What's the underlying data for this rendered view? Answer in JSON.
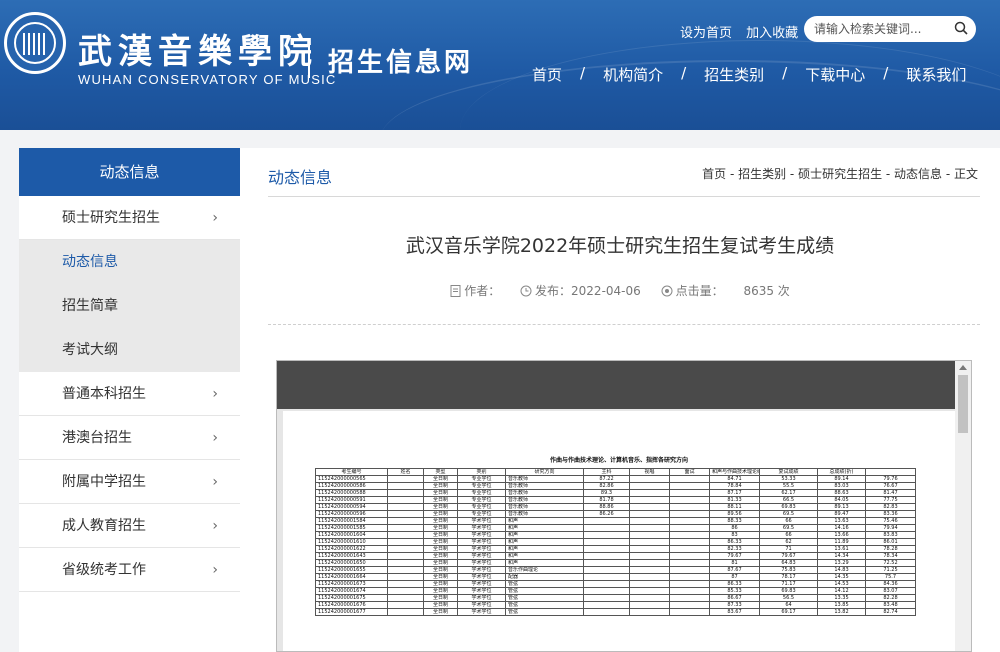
{
  "header": {
    "logo_cn": "武漢音樂學院",
    "logo_en": "WUHAN CONSERVATORY OF MUSIC",
    "site_name": "招生信息网",
    "top_links": [
      "设为首页",
      "加入收藏"
    ],
    "search_placeholder": "请输入检索关键词...",
    "nav": [
      "首页",
      "机构简介",
      "招生类别",
      "下载中心",
      "联系我们"
    ]
  },
  "sidebar": {
    "title": "动态信息",
    "items": [
      {
        "label": "硕士研究生招生"
      },
      {
        "label": "动态信息"
      },
      {
        "label": "招生简章"
      },
      {
        "label": "考试大纲"
      },
      {
        "label": "普通本科招生"
      },
      {
        "label": "港澳台招生"
      },
      {
        "label": "附属中学招生"
      },
      {
        "label": "成人教育招生"
      },
      {
        "label": "省级统考工作"
      }
    ]
  },
  "main": {
    "section_title": "动态信息",
    "breadcrumb": "首页 - 招生类别 - 硕士研究生招生 - 动态信息 - 正文",
    "article_title": "武汉音乐学院2022年硕士研究生招生复试考生成绩",
    "meta": {
      "author_label": "作者：",
      "date_label": "发布：2022-04-06",
      "views_label": "点击量：",
      "views_value": "8635 次"
    }
  },
  "document": {
    "heading": "作曲与作曲技术理论、计算机音乐、指挥各研究方向",
    "columns": [
      "考生编号",
      "姓名",
      "类型",
      "类别",
      "研究方向",
      "主科",
      "视唱",
      "面试",
      "和声与作曲技术理论综合",
      "复试成绩",
      "总成绩(折)"
    ],
    "rows": [
      [
        "115242000000565",
        "",
        "全日制",
        "专业学位",
        "音乐教师",
        "87.22",
        "",
        "",
        "84.71",
        "53.33",
        "89.14",
        "79.76"
      ],
      [
        "115242000000586",
        "",
        "全日制",
        "专业学位",
        "音乐教师",
        "82.86",
        "",
        "",
        "78.84",
        "55.5",
        "83.03",
        "76.67"
      ],
      [
        "115242000000588",
        "",
        "全日制",
        "专业学位",
        "音乐教师",
        "89.3",
        "",
        "",
        "87.17",
        "62.17",
        "88.63",
        "81.47"
      ],
      [
        "115242000000591",
        "",
        "全日制",
        "专业学位",
        "音乐教师",
        "81.78",
        "",
        "",
        "81.33",
        "66.5",
        "84.05",
        "77.75"
      ],
      [
        "115242000000594",
        "",
        "全日制",
        "专业学位",
        "音乐教师",
        "88.86",
        "",
        "",
        "88.11",
        "69.83",
        "89.13",
        "82.83"
      ],
      [
        "115242000000596",
        "",
        "全日制",
        "专业学位",
        "音乐教师",
        "86.26",
        "",
        "",
        "89.56",
        "69.5",
        "89.47",
        "83.36"
      ],
      [
        "115242000001584",
        "",
        "全日制",
        "学术学位",
        "和声",
        "",
        "",
        "",
        "88.33",
        "66",
        "13.63",
        "75.46"
      ],
      [
        "115242000001585",
        "",
        "全日制",
        "学术学位",
        "和声",
        "",
        "",
        "",
        "86",
        "69.5",
        "14.16",
        "79.94"
      ],
      [
        "115242000001604",
        "",
        "全日制",
        "学术学位",
        "和声",
        "",
        "",
        "",
        "83",
        "66",
        "13.66",
        "83.83"
      ],
      [
        "115242000001610",
        "",
        "全日制",
        "学术学位",
        "和声",
        "",
        "",
        "",
        "86.33",
        "62",
        "11.89",
        "86.01"
      ],
      [
        "115242000001622",
        "",
        "全日制",
        "学术学位",
        "和声",
        "",
        "",
        "",
        "82.33",
        "71",
        "13.61",
        "78.28"
      ],
      [
        "115242000001643",
        "",
        "全日制",
        "学术学位",
        "和声",
        "",
        "",
        "",
        "79.67",
        "79.67",
        "14.34",
        "78.34"
      ],
      [
        "115242000001650",
        "",
        "全日制",
        "学术学位",
        "和声",
        "",
        "",
        "",
        "81",
        "64.83",
        "13.29",
        "72.52"
      ],
      [
        "115242000001655",
        "",
        "全日制",
        "学术学位",
        "音乐作曲理论",
        "",
        "",
        "",
        "87.67",
        "75.83",
        "14.83",
        "71.25"
      ],
      [
        "115242000001664",
        "",
        "全日制",
        "学术学位",
        "配器",
        "",
        "",
        "",
        "87",
        "78.17",
        "14.35",
        "75.7"
      ],
      [
        "115242000001673",
        "",
        "全日制",
        "学术学位",
        "管弦",
        "",
        "",
        "",
        "86.33",
        "71.17",
        "14.53",
        "84.36"
      ],
      [
        "115242000001674",
        "",
        "全日制",
        "学术学位",
        "管弦",
        "",
        "",
        "",
        "85.33",
        "69.83",
        "14.12",
        "83.07"
      ],
      [
        "115242000001675",
        "",
        "全日制",
        "学术学位",
        "管弦",
        "",
        "",
        "",
        "86.67",
        "56.5",
        "13.35",
        "82.28"
      ],
      [
        "115242000001676",
        "",
        "全日制",
        "学术学位",
        "管弦",
        "",
        "",
        "",
        "87.33",
        "64",
        "13.85",
        "83.48"
      ],
      [
        "115242000001677",
        "",
        "全日制",
        "学术学位",
        "管弦",
        "",
        "",
        "",
        "83.67",
        "69.17",
        "13.82",
        "82.74"
      ]
    ]
  },
  "colors": {
    "header_blue": "#1f5aa5",
    "accent_blue": "#1d5aa8"
  }
}
